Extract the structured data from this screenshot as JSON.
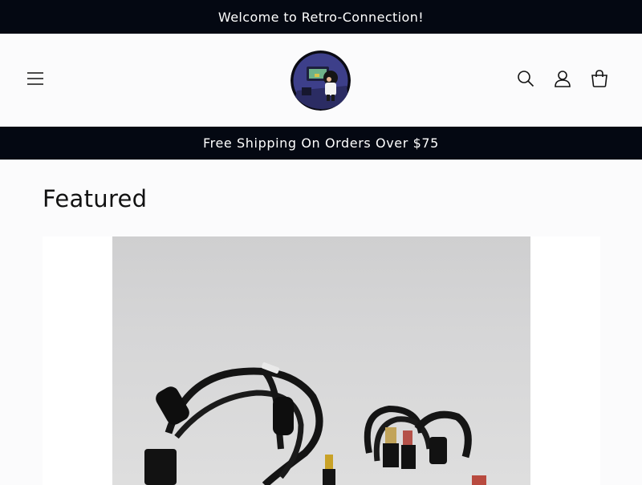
{
  "announcement": {
    "text": "Welcome to Retro-Connection!"
  },
  "header": {
    "menu_icon": "hamburger-menu-icon",
    "logo_icon": "retro-gamer-logo",
    "search_icon": "search-icon",
    "account_icon": "account-icon",
    "cart_icon": "cart-icon"
  },
  "promo": {
    "text": "Free Shipping On Orders Over $75"
  },
  "featured": {
    "title": "Featured",
    "product_image": "av-cable-product-image"
  },
  "colors": {
    "bar_background": "#040812",
    "page_background": "#fbfbfc",
    "text": "#121212"
  }
}
